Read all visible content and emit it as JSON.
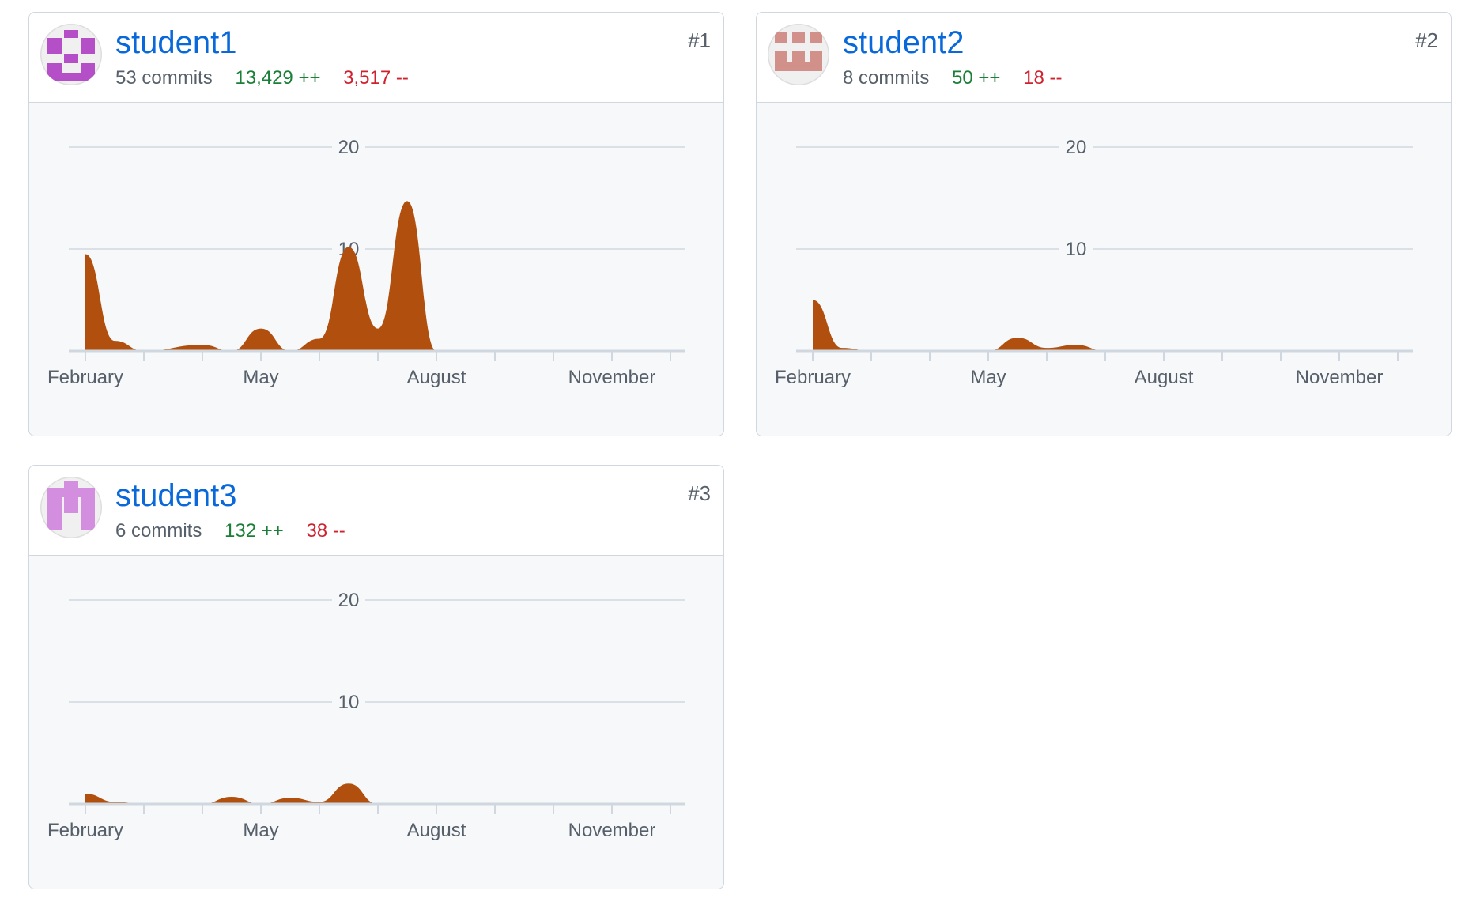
{
  "contributors": [
    {
      "name": "student1",
      "rank": "#1",
      "commits": "53 commits",
      "additions": "13,429 ++",
      "deletions": "3,517 --",
      "avatar_color": "#b54fc7"
    },
    {
      "name": "student2",
      "rank": "#2",
      "commits": "8 commits",
      "additions": "50 ++",
      "deletions": "18 --",
      "avatar_color": "#d2908a"
    },
    {
      "name": "student3",
      "rank": "#3",
      "commits": "6 commits",
      "additions": "132 ++",
      "deletions": "38 --",
      "avatar_color": "#d48ee0"
    }
  ],
  "chart_data": [
    {
      "type": "area",
      "title": "",
      "xlabel": "",
      "ylabel": "",
      "x_ticks": [
        "February",
        "May",
        "August",
        "November"
      ],
      "y_ticks": [
        10,
        20
      ],
      "ylim": [
        0,
        20
      ],
      "grid": true,
      "color": "#b1500e",
      "series": [
        {
          "x": [
            0,
            0.5,
            1,
            2,
            2.5,
            3,
            3.5,
            4,
            4.5,
            5,
            5.5,
            6,
            7,
            8,
            9,
            10,
            11
          ],
          "values": [
            9.5,
            1,
            0,
            0.6,
            0,
            2.2,
            0,
            1.2,
            10.2,
            2.2,
            14.7,
            0,
            0,
            0,
            0,
            0,
            0
          ]
        }
      ]
    },
    {
      "type": "area",
      "title": "",
      "xlabel": "",
      "ylabel": "",
      "x_ticks": [
        "February",
        "May",
        "August",
        "November"
      ],
      "y_ticks": [
        10,
        20
      ],
      "ylim": [
        0,
        20
      ],
      "grid": true,
      "color": "#b1500e",
      "series": [
        {
          "x": [
            0,
            0.5,
            1,
            2,
            2.5,
            3,
            3.5,
            4,
            4.5,
            5,
            5.5,
            6,
            7,
            8,
            9,
            10,
            11
          ],
          "values": [
            5,
            0.3,
            0,
            0,
            0,
            0,
            1.3,
            0.3,
            0.6,
            0,
            0,
            0,
            0,
            0,
            0,
            0,
            0
          ]
        }
      ]
    },
    {
      "type": "area",
      "title": "",
      "xlabel": "",
      "ylabel": "",
      "x_ticks": [
        "February",
        "May",
        "August",
        "November"
      ],
      "y_ticks": [
        10,
        20
      ],
      "ylim": [
        0,
        20
      ],
      "grid": true,
      "color": "#b1500e",
      "series": [
        {
          "x": [
            0,
            0.5,
            1,
            2,
            2.5,
            3,
            3.5,
            4,
            4.5,
            5,
            5.5,
            6,
            7,
            8,
            9,
            10,
            11
          ],
          "values": [
            1,
            0.2,
            0,
            0,
            0.7,
            0,
            0.6,
            0.2,
            2,
            0,
            0,
            0,
            0,
            0,
            0,
            0,
            0
          ]
        }
      ]
    }
  ]
}
